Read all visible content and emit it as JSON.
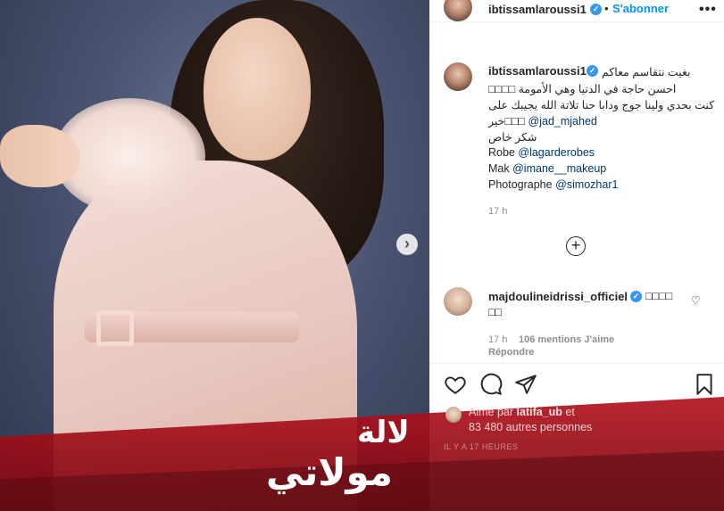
{
  "header": {
    "username": "ibtissamlaroussi1",
    "separator": "•",
    "follow_label": "S'abonner",
    "more_icon": "•••"
  },
  "caption": {
    "username": "ibtissamlaroussi1",
    "lines": [
      "بغيت نتقاسم معاكم",
      "□□□□ احسن حاجة في الدنيا وهي الأمومة",
      "كنت بحدي ولينا جوج ودابا حنا تلاتة الله يجيبك على",
      "خير□□□",
      "شكر خاص"
    ],
    "mention_jad": "@jad_mjahed",
    "robe_label": "Robe",
    "robe_mention": "@lagarderobes",
    "mak_label": "Mak",
    "mak_mention": "@imane__makeup",
    "photo_label": "Photographe",
    "photo_mention": "@simozhar1",
    "time": "17 h"
  },
  "comment": {
    "username": "majdoulineidrissi_officiel",
    "text_1": "□□□□",
    "text_2": "□□",
    "time": "17 h",
    "likes": "106 mentions J'aime",
    "reply_label": "Répondre"
  },
  "footer": {
    "liked_by_prefix": "Aimé par",
    "liked_by_user": "latifa_ub",
    "liked_by_connector": "et",
    "liked_by_count": "83 480 autres personnes",
    "time_ago": "IL Y A 17 HEURES"
  },
  "watermark": {
    "line_1": "لالة",
    "line_2": "مولاتي"
  },
  "icons": {
    "next": "chevron-right-icon",
    "load_more": "plus-circle-icon",
    "like": "heart-icon",
    "comment": "comment-icon",
    "share": "share-icon",
    "save": "bookmark-icon"
  },
  "colors": {
    "link": "#0095f6",
    "mention": "#00376b",
    "verified": "#3897f0",
    "banner_red": "#b3121e"
  }
}
